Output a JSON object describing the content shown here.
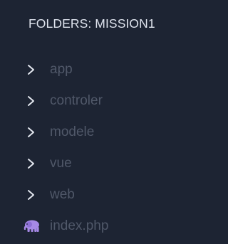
{
  "explorer": {
    "header": "FOLDERS: MISSION1",
    "items": [
      {
        "label": "app",
        "kind": "folder",
        "icon": "chevron-right-icon"
      },
      {
        "label": "controler",
        "kind": "folder",
        "icon": "chevron-right-icon"
      },
      {
        "label": "modele",
        "kind": "folder",
        "icon": "chevron-right-icon"
      },
      {
        "label": "vue",
        "kind": "folder",
        "icon": "chevron-right-icon"
      },
      {
        "label": "web",
        "kind": "folder",
        "icon": "chevron-right-icon"
      },
      {
        "label": "index.php",
        "kind": "file",
        "icon": "php-elephant-icon"
      }
    ]
  },
  "colors": {
    "background": "#1d2433",
    "header_text": "#dfe4ee",
    "item_text": "#505869",
    "chevron": "#e3e7ef",
    "php_icon": "#a689e6"
  }
}
